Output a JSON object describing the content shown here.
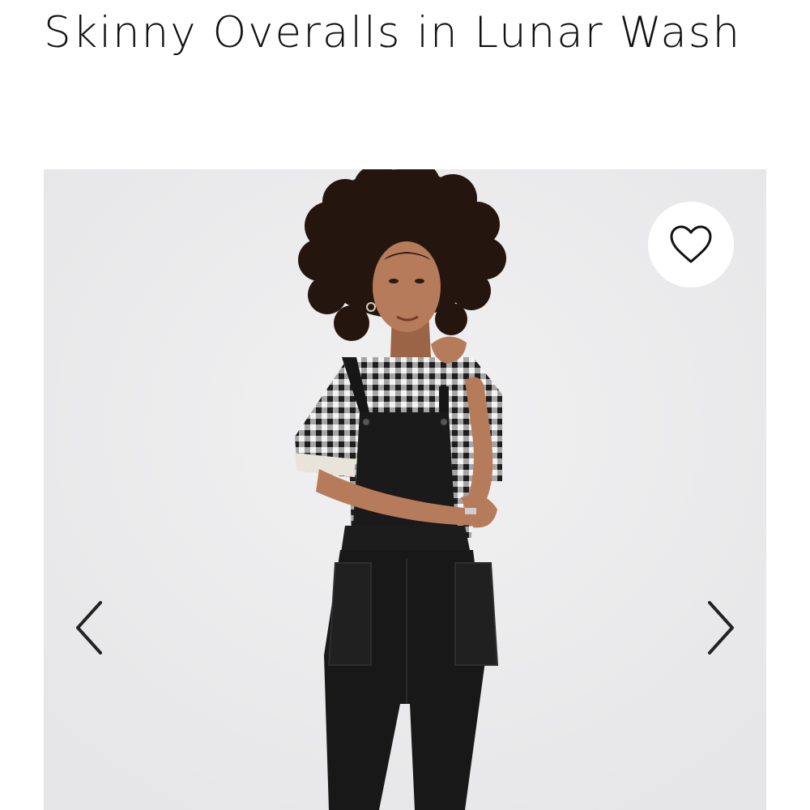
{
  "product": {
    "title": "Skinny Overalls in Lunar Wash"
  },
  "gallery": {
    "image_subject": "model-wearing-black-overalls",
    "favorite_icon": "heart-outline-icon",
    "prev_icon": "chevron-left-icon",
    "next_icon": "chevron-right-icon"
  },
  "colors": {
    "background": "#ffffff",
    "photo_background": "#ececed",
    "text": "#111111",
    "overalls": "#1a1a1a",
    "skin": "#b57b5a",
    "hair": "#2a1a14"
  }
}
